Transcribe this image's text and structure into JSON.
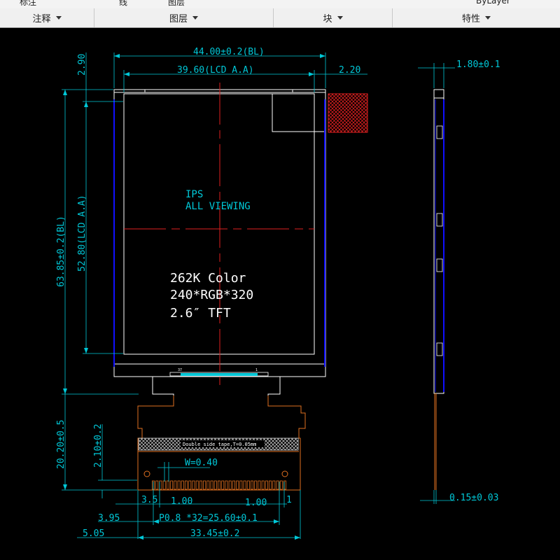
{
  "ribbon": {
    "top_fragments": [
      "标注",
      "线",
      "图层",
      "ByLayer"
    ],
    "panels": [
      {
        "label": "注释"
      },
      {
        "label": "图层"
      },
      {
        "label": "块"
      },
      {
        "label": "特性"
      }
    ]
  },
  "drawing": {
    "colors": {
      "background": "#000000",
      "dimension": "#00c8d8",
      "outline": "#ffffff",
      "centerline": "#e02020",
      "fpc": "#e07020",
      "backlight_edge": "#1010ff"
    },
    "top_dims": {
      "bl_width": "44.00±0.2(BL)",
      "aa_width": "39.60(LCD A.A)",
      "offset_right": "2.20"
    },
    "left_dims": {
      "offset_top": "2.90",
      "bl_height": "63.85±0.2(BL)",
      "aa_height": "52.80(LCD A.A)",
      "fpc_length": "20.20±0.5",
      "fpc_tab": "2.10±0.2"
    },
    "screen_text": {
      "line1": "IPS",
      "line2": "ALL VIEWING",
      "color_depth": "262K Color",
      "resolution": "240*RGB*320",
      "size": "2.6″ TFT"
    },
    "connector": {
      "pin_left": "37",
      "pin_right": "1",
      "tape_note": "Double side tape,T=0.05mm"
    },
    "bottom_dims": {
      "width_w": "W=0.40",
      "d35": "3.5",
      "pitch_left": "1.00",
      "pitch_right": "1.00",
      "edge_right": "1",
      "d395": "3.95",
      "pitch_total": "P0.8 *32=25.60±0.1",
      "d505": "5.05",
      "fpc_width": "33.45±0.2"
    },
    "side_dims": {
      "thickness": "1.80±0.1",
      "fpc_thickness": "0.15±0.03"
    }
  }
}
